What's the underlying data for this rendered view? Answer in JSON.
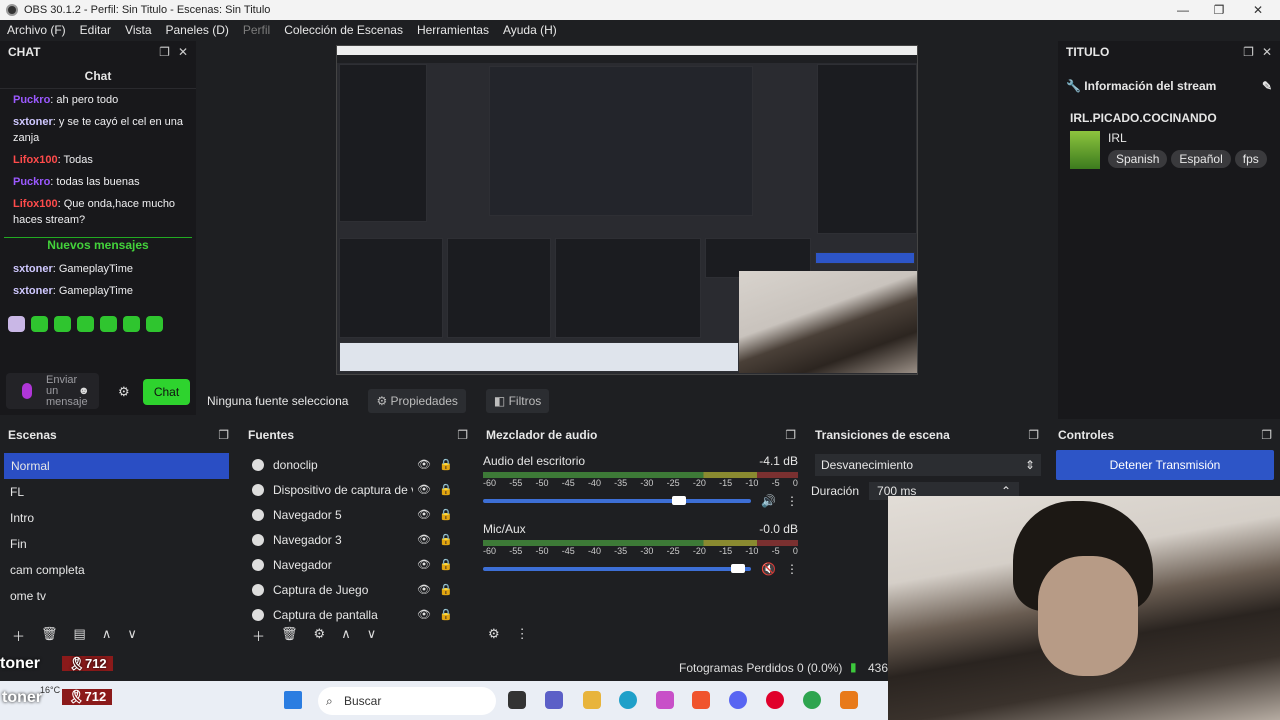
{
  "window": {
    "title": "OBS 30.1.2 - Perfil: Sin Titulo - Escenas: Sin Titulo",
    "minimize": "—",
    "maximize": "❐",
    "close": "✕"
  },
  "menu": [
    "Archivo (F)",
    "Editar",
    "Vista",
    "Paneles (D)",
    "Perfil",
    "Colección de Escenas",
    "Herramientas",
    "Ayuda (H)"
  ],
  "chat_dock": {
    "title": "CHAT",
    "header": "Chat",
    "messages": [
      {
        "user": "Puckro",
        "color": "#9b59ff",
        "text": ": ah pero todo"
      },
      {
        "user": "sxtoner",
        "color": "#cfc8ff",
        "text": ": y se te cayó el cel en una zanja"
      },
      {
        "user": "Lifox100",
        "color": "#ff4b4b",
        "text": ": Todas"
      },
      {
        "user": "Puckro",
        "color": "#9b59ff",
        "text": ": todas las buenas"
      },
      {
        "user": "Lifox100",
        "color": "#ff4b4b",
        "text": ": Que onda,hace mucho haces stream?"
      }
    ],
    "new_messages": "Nuevos mensajes",
    "messages_after": [
      {
        "user": "sxtoner",
        "color": "#cfc8ff",
        "text": ": GameplayTime"
      },
      {
        "user": "sxtoner",
        "color": "#cfc8ff",
        "text": ": GameplayTime"
      }
    ],
    "input_placeholder": "Enviar un mensaje",
    "send_button": "Chat"
  },
  "source_toolbar": {
    "no_source": "Ninguna fuente selecciona",
    "properties": "Propiedades",
    "filters": "Filtros"
  },
  "title_dock": {
    "title": "TITULO",
    "stream_info": "Información del stream",
    "channel": "IRL.PICADO.COCINANDO",
    "category": "IRL",
    "tags": [
      "Spanish",
      "Español",
      "fps"
    ]
  },
  "scenes": {
    "title": "Escenas",
    "items": [
      "Normal",
      "FL",
      "Intro",
      "Fin",
      "cam completa",
      "ome tv"
    ],
    "selected": "Normal"
  },
  "sources": {
    "title": "Fuentes",
    "items": [
      "donoclip",
      "Dispositivo de captura de vi",
      "Navegador 5",
      "Navegador 3",
      "Navegador",
      "Captura de Juego",
      "Captura de pantalla"
    ]
  },
  "mixer": {
    "title": "Mezclador de audio",
    "channels": [
      {
        "name": "Audio del escritorio",
        "db": "-4.1 dB",
        "volume": 0.73
      },
      {
        "name": "Mic/Aux",
        "db": "-0.0 dB",
        "volume": 0.95
      }
    ],
    "scale": [
      "-60",
      "-55",
      "-50",
      "-45",
      "-40",
      "-35",
      "-30",
      "-25",
      "-20",
      "-15",
      "-10",
      "-5",
      "0"
    ]
  },
  "transitions": {
    "title": "Transiciones de escena",
    "selected": "Desvanecimiento",
    "duration_label": "Duración",
    "duration_value": "700 ms"
  },
  "controls": {
    "title": "Controles",
    "stop_stream": "Detener Transmisión"
  },
  "status": {
    "dropped_frames": "Fotogramas Perdidos 0 (0.0%)",
    "bitrate": "436"
  },
  "taskbar": {
    "search_placeholder": "Buscar",
    "weather": "16°C"
  },
  "overlay": {
    "name": "toner",
    "badge": "712"
  }
}
